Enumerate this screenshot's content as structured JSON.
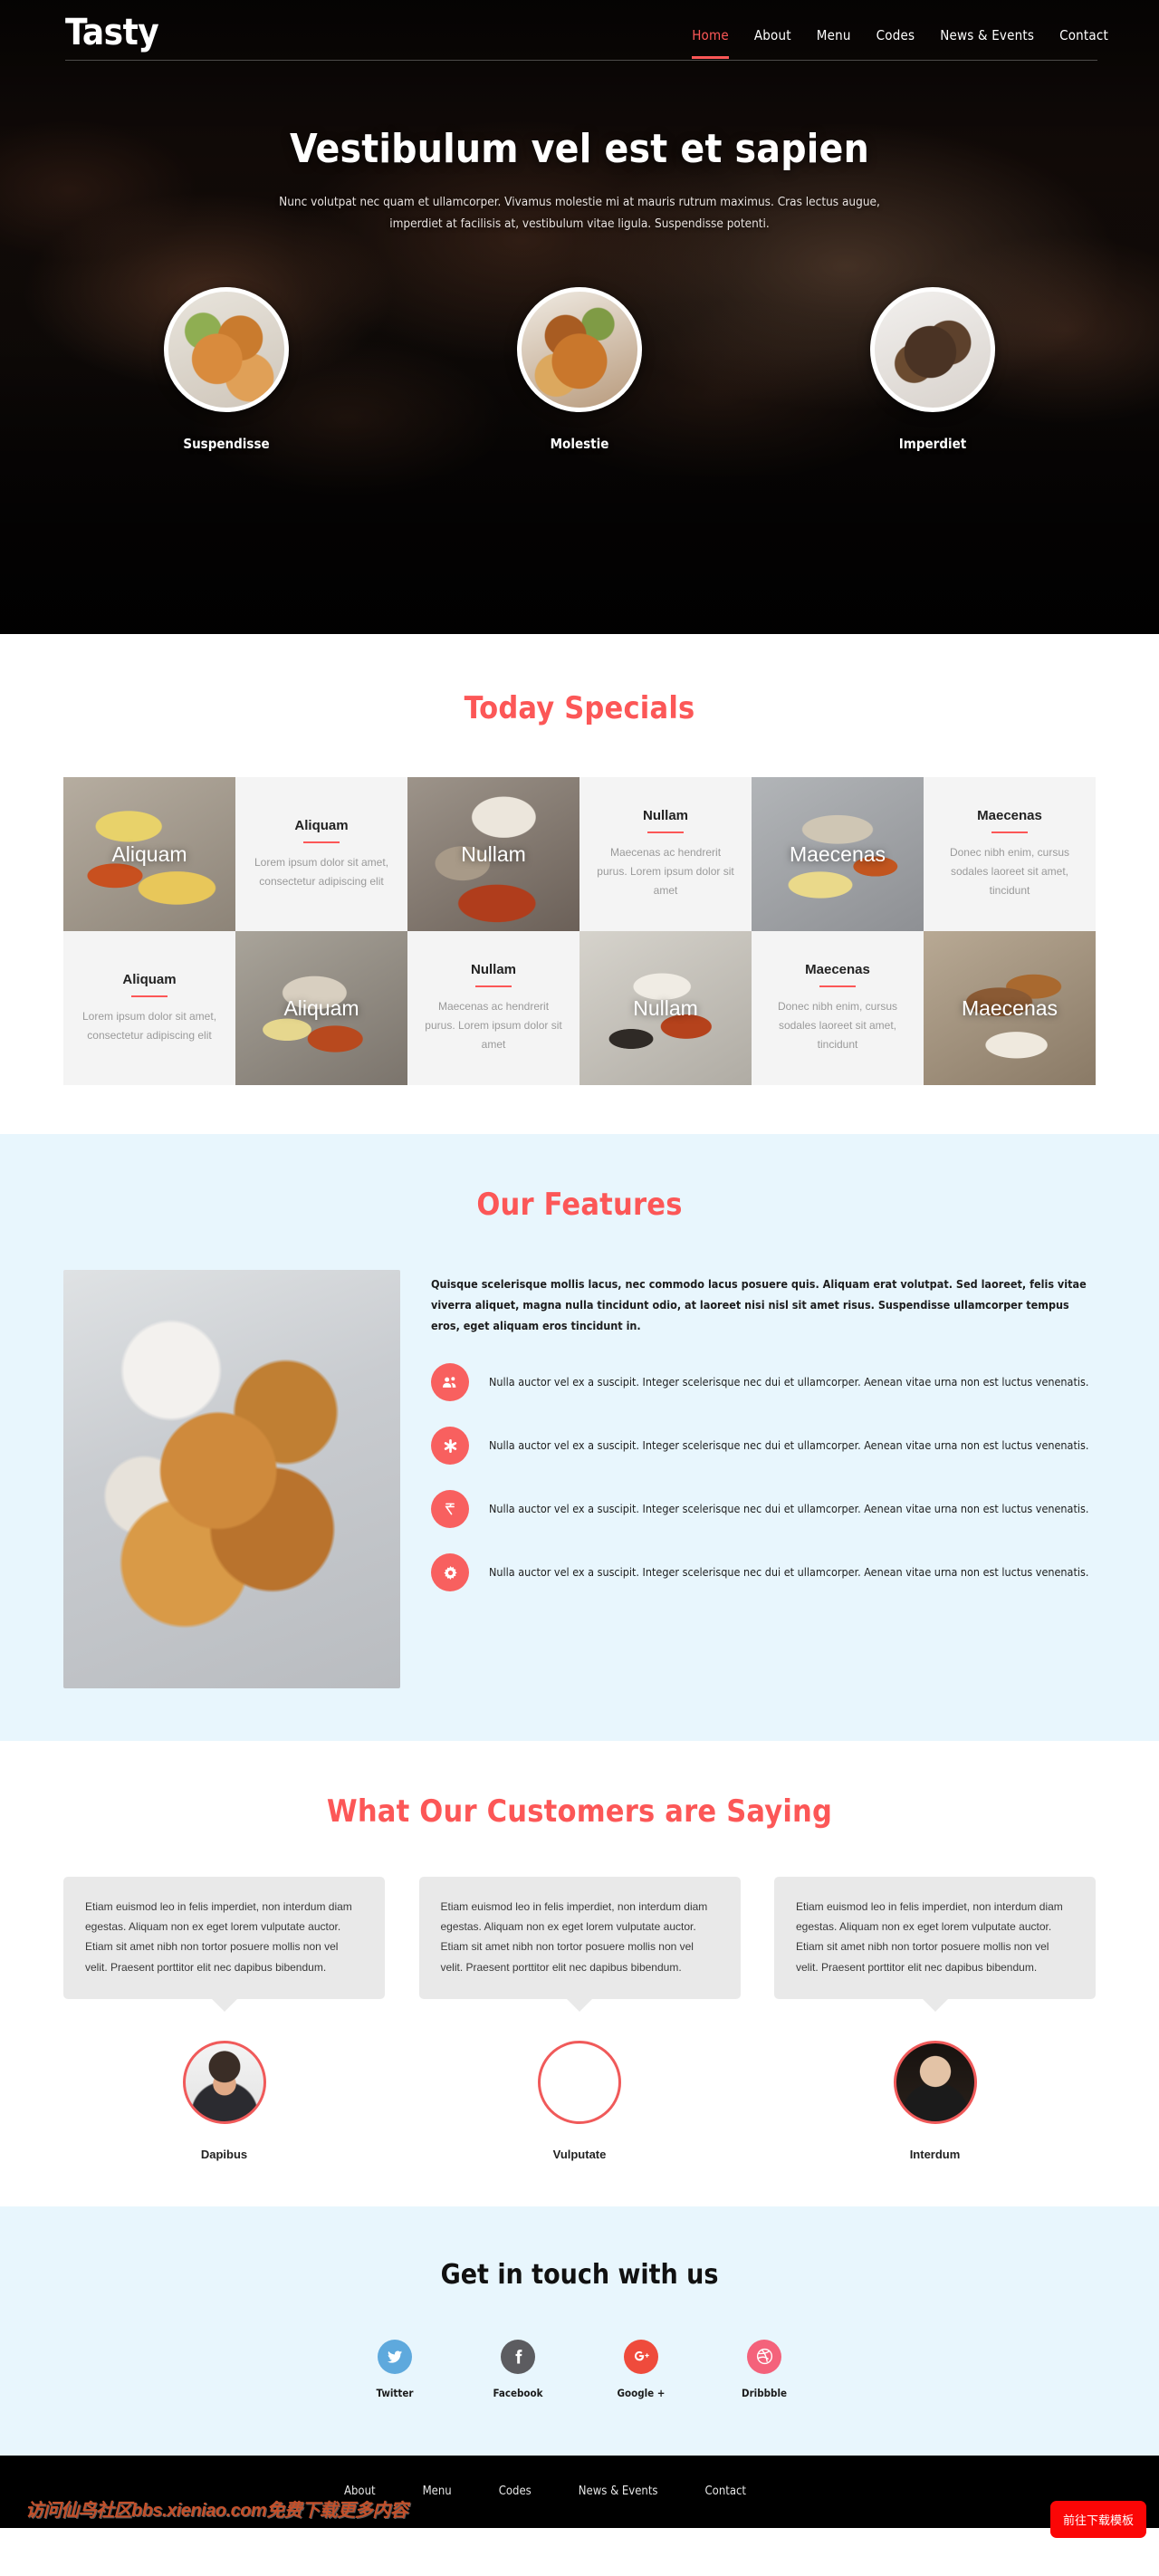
{
  "brand": {
    "logo": "Tasty"
  },
  "nav": {
    "items": [
      {
        "label": "Home",
        "active": true
      },
      {
        "label": "About",
        "active": false
      },
      {
        "label": "Menu",
        "active": false
      },
      {
        "label": "Codes",
        "active": false
      },
      {
        "label": "News & Events",
        "active": false
      },
      {
        "label": "Contact",
        "active": false
      }
    ]
  },
  "hero": {
    "title": "Vestibulum vel est et sapien",
    "subtitle": "Nunc volutpat nec quam et ullamcorper. Vivamus molestie mi at mauris rutrum maximus. Cras lectus augue, imperdiet at facilisis at, vestibulum vitae ligula. Suspendisse potenti.",
    "circles": [
      {
        "label": "Suspendisse",
        "image": "fried-chicken-photo"
      },
      {
        "label": "Molestie",
        "image": "braised-chicken-bowl-photo"
      },
      {
        "label": "Imperdiet",
        "image": "grilled-meat-plate-photo"
      }
    ]
  },
  "specials": {
    "heading": "Today Specials",
    "cells": [
      {
        "type": "image",
        "title": "Aliquam",
        "image": "pasta-plate-photo"
      },
      {
        "type": "text",
        "title": "Aliquam",
        "body": "Lorem ipsum dolor sit amet, consectetur adipiscing elit"
      },
      {
        "type": "image",
        "title": "Nullam",
        "image": "meat-stew-photo"
      },
      {
        "type": "text",
        "title": "Nullam",
        "body": "Maecenas ac hendrerit purus. Lorem ipsum dolor sit amet"
      },
      {
        "type": "image",
        "title": "Maecenas",
        "image": "sashimi-chopsticks-photo"
      },
      {
        "type": "text",
        "title": "Maecenas",
        "body": "Donec nibh enim, cursus sodales laoreet sit amet, tincidunt"
      },
      {
        "type": "text",
        "title": "Aliquam",
        "body": "Lorem ipsum dolor sit amet, consectetur adipiscing elit"
      },
      {
        "type": "image",
        "title": "Aliquam",
        "image": "steak-chopsticks-photo"
      },
      {
        "type": "text",
        "title": "Nullam",
        "body": "Maecenas ac hendrerit purus. Lorem ipsum dolor sit amet"
      },
      {
        "type": "image",
        "title": "Nullam",
        "image": "white-plate-dish-photo"
      },
      {
        "type": "text",
        "title": "Maecenas",
        "body": "Donec nibh enim, cursus sodales laoreet sit amet, tincidunt"
      },
      {
        "type": "image",
        "title": "Maecenas",
        "image": "roast-meat-photo"
      }
    ]
  },
  "features": {
    "heading": "Our Features",
    "image": "fried-chicken-wings-plate-photo",
    "lead": "Quisque scelerisque mollis lacus, nec commodo lacus posuere quis. Aliquam erat volutpat. Sed laoreet, felis vitae viverra aliquet, magna nulla tincidunt odio, at laoreet nisi nisl sit amet risus. Suspendisse ullamcorper tempus eros, eget aliquam eros tincidunt in.",
    "items": [
      {
        "icon": "users-group-icon",
        "glyph": "\u0000",
        "text": "Nulla auctor vel ex a suscipit. Integer scelerisque nec dui et ullamcorper. Aenean vitae urna non est luctus venenatis."
      },
      {
        "icon": "asterisk-icon",
        "glyph": "✱",
        "text": "Nulla auctor vel ex a suscipit. Integer scelerisque nec dui et ullamcorper. Aenean vitae urna non est luctus venenatis."
      },
      {
        "icon": "rupee-currency-icon",
        "glyph": "₹",
        "text": "Nulla auctor vel ex a suscipit. Integer scelerisque nec dui et ullamcorper. Aenean vitae urna non est luctus venenatis."
      },
      {
        "icon": "gear-icon",
        "glyph": "⚙",
        "text": "Nulla auctor vel ex a suscipit. Integer scelerisque nec dui et ullamcorper. Aenean vitae urna non est luctus venenatis."
      }
    ]
  },
  "testimonials": {
    "heading": "What Our Customers are Saying",
    "items": [
      {
        "quote": "Etiam euismod leo in felis imperdiet, non interdum diam egestas. Aliquam non ex eget lorem vulputate auctor. Etiam sit amet nibh non tortor posuere mollis non vel velit. Praesent porttitor elit nec dapibus bibendum.",
        "name": "Dapibus",
        "avatar": "man-suit-portrait-photo"
      },
      {
        "quote": "Etiam euismod leo in felis imperdiet, non interdum diam egestas. Aliquam non ex eget lorem vulputate auctor. Etiam sit amet nibh non tortor posuere mollis non vel velit. Praesent porttitor elit nec dapibus bibendum.",
        "name": "Vulputate",
        "avatar": "woman-suit-portrait-photo"
      },
      {
        "quote": "Etiam euismod leo in felis imperdiet, non interdum diam egestas. Aliquam non ex eget lorem vulputate auctor. Etiam sit amet nibh non tortor posuere mollis non vel velit. Praesent porttitor elit nec dapibus bibendum.",
        "name": "Interdum",
        "avatar": "older-man-portrait-photo"
      }
    ]
  },
  "contact": {
    "heading": "Get in touch with us",
    "socials": [
      {
        "name": "Twitter",
        "icon": "twitter-icon",
        "glyph": "ὂ6",
        "color": "#5ea9dd"
      },
      {
        "name": "Facebook",
        "icon": "facebook-icon",
        "glyph": "f",
        "color": "#5c5c60"
      },
      {
        "name": "Google +",
        "icon": "google-plus-icon",
        "glyph": "g+",
        "color": "#ef4b3c"
      },
      {
        "name": "Dribbble",
        "icon": "dribbble-icon",
        "glyph": "⚽",
        "color": "#f4627b"
      }
    ]
  },
  "footer": {
    "items": [
      {
        "label": "About"
      },
      {
        "label": "Menu"
      },
      {
        "label": "Codes"
      },
      {
        "label": "News & Events"
      },
      {
        "label": "Contact"
      }
    ],
    "watermark": "访问仙鸟社区bbs.xieniao.com免费下载更多内容",
    "download_button": "前往下载模板"
  },
  "colors": {
    "accent": "#fc5757",
    "feature_bg": "#e8f6fd",
    "card_bg": "#f4f4f4",
    "bubble_bg": "#e9e9e9"
  }
}
